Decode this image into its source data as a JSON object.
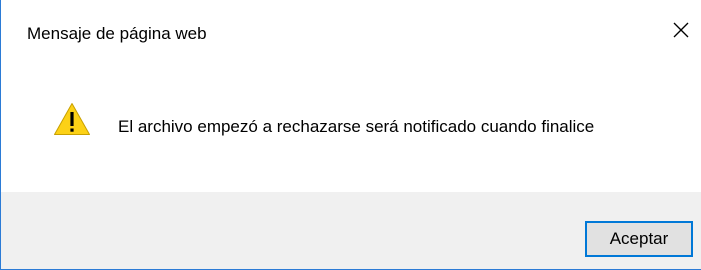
{
  "dialog": {
    "title": "Mensaje de página web",
    "close_icon": "close-icon",
    "icon": "warning-icon",
    "message": "El archivo empezó a rechazarse será notificado cuando finalice",
    "ok_label": "Aceptar"
  },
  "colors": {
    "accent_border": "#0078d7",
    "footer_background": "#f0f0f0",
    "warning_fill": "#fcd116"
  }
}
